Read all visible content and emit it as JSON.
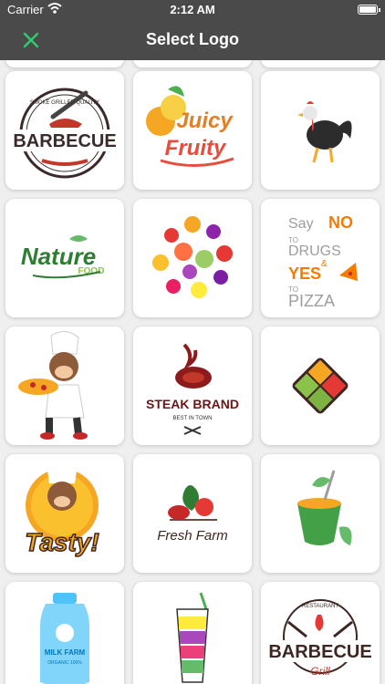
{
  "status_bar": {
    "carrier": "Carrier",
    "time": "2:12 AM"
  },
  "nav": {
    "title": "Select Logo",
    "close_icon": "close-x-icon",
    "accent": "#2ecc71"
  },
  "logos": [
    {
      "name": "barbecue-logo",
      "text": "BARBECUE",
      "subtext": "SMOKE GRILLED QUALITY"
    },
    {
      "name": "juicy-fruity-logo",
      "text": "Juicy",
      "subtext": "Fruity"
    },
    {
      "name": "rooster-logo"
    },
    {
      "name": "nature-food-logo",
      "text": "Nature",
      "subtext": "FOOD"
    },
    {
      "name": "fruits-circle-logo"
    },
    {
      "name": "say-no-to-drugs-logo",
      "line1": "Say",
      "line1b": "NO",
      "line2": "TO",
      "line3": "DRUGS",
      "line4": "&",
      "line5": "YES",
      "line6": "TO",
      "line7": "PIZZA"
    },
    {
      "name": "monkey-chef-pizza-logo"
    },
    {
      "name": "steak-brand-logo",
      "text": "STEAK BRAND",
      "subtext": "BEST IN TOWN"
    },
    {
      "name": "food-boxes-logo"
    },
    {
      "name": "tasty-chef-logo",
      "text": "Tasty!"
    },
    {
      "name": "fresh-farm-logo",
      "text": "Fresh Farm"
    },
    {
      "name": "coconut-drink-logo"
    },
    {
      "name": "milk-farm-logo",
      "text": "MILK FARM",
      "subtext": "ORGANIC 100%"
    },
    {
      "name": "juice-glass-logo"
    },
    {
      "name": "barbecue-grill-logo",
      "text": "BARBECUE",
      "subtext": "Grill",
      "top": "RESTAURANT"
    }
  ]
}
